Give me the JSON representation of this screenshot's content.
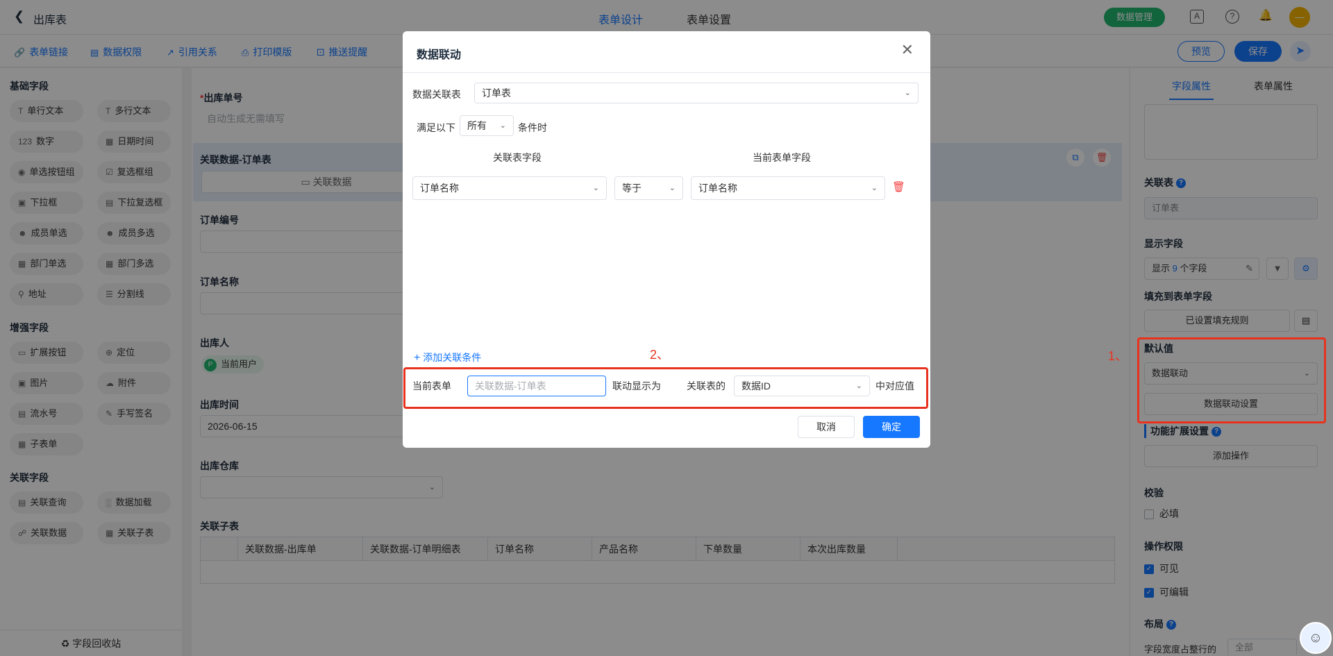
{
  "topbar": {
    "title": "出库表",
    "tabs": [
      "表单设计",
      "表单设置"
    ],
    "data_manage": "数据管理"
  },
  "toolbar": {
    "items": [
      "表单链接",
      "数据权限",
      "引用关系",
      "打印模版",
      "推送提醒"
    ],
    "preview": "预览",
    "save": "保存"
  },
  "palette": {
    "groups": [
      "基础字段",
      "增强字段",
      "关联字段"
    ],
    "basic": [
      "单行文本",
      "多行文本",
      "数字",
      "日期时间",
      "单选按钮组",
      "复选框组",
      "下拉框",
      "下拉复选框",
      "成员单选",
      "成员多选",
      "部门单选",
      "部门多选",
      "地址",
      "分割线"
    ],
    "enhanced": [
      "扩展按钮",
      "定位",
      "图片",
      "附件",
      "流水号",
      "手写签名",
      "子表单"
    ],
    "related": [
      "关联查询",
      "数据加载",
      "关联数据",
      "关联子表"
    ],
    "recycle": "字段回收站"
  },
  "canvas": {
    "f1_label": "出库单号",
    "f1_placeholder": "自动生成无需填写",
    "f2_label": "关联数据-订单表",
    "f2_button": "关联数据",
    "f3_label": "订单编号",
    "f4_label": "订单名称",
    "f5_label": "出库人",
    "f5_value": "当前用户",
    "f6_label": "出库时间",
    "f6_value": "2026-06-15",
    "f7_label": "出库仓库",
    "f8_label": "关联子表",
    "sub_headers": [
      "关联数据-出库单",
      "关联数据-订单明细表",
      "订单名称",
      "产品名称",
      "下单数量",
      "本次出库数量"
    ]
  },
  "rpanel": {
    "tabs": [
      "字段属性",
      "表单属性"
    ],
    "rel_table_label": "关联表",
    "rel_table_value": "订单表",
    "display_label": "显示字段",
    "display_prefix": "显示",
    "display_count": "9",
    "display_suffix": "个字段",
    "fill_label": "填充到表单字段",
    "fill_button": "已设置填充规则",
    "default_label": "默认值",
    "default_value": "数据联动",
    "linkage_button": "数据联动设置",
    "ext_label": "功能扩展设置",
    "add_action": "添加操作",
    "verify_label": "校验",
    "required": "必填",
    "perm_label": "操作权限",
    "visible": "可见",
    "editable": "可编辑",
    "layout_label": "布局",
    "width_label": "字段宽度占整行的",
    "width_value": "全部"
  },
  "modal": {
    "title": "数据联动",
    "rel_table_label": "数据关联表",
    "rel_table_value": "订单表",
    "cond_prefix": "满足以下",
    "cond_value": "所有",
    "cond_suffix": "条件时",
    "col_rel": "关联表字段",
    "col_cur": "当前表单字段",
    "row_left": "订单名称",
    "row_op": "等于",
    "row_right": "订单名称",
    "add_condition": "添加关联条件",
    "cur_form": "当前表单",
    "cur_field_placeholder": "关联数据-订单表",
    "show_as": "联动显示为",
    "rel_of": "关联表的",
    "rel_field": "数据ID",
    "match": "中对应值",
    "cancel": "取消",
    "ok": "确定"
  },
  "annotations": {
    "a1": "1、",
    "a2": "2、"
  },
  "colors": {
    "accent": "#1677ff",
    "annotation": "#e8321e",
    "green": "#21b66f",
    "danger": "#f53f3f"
  }
}
